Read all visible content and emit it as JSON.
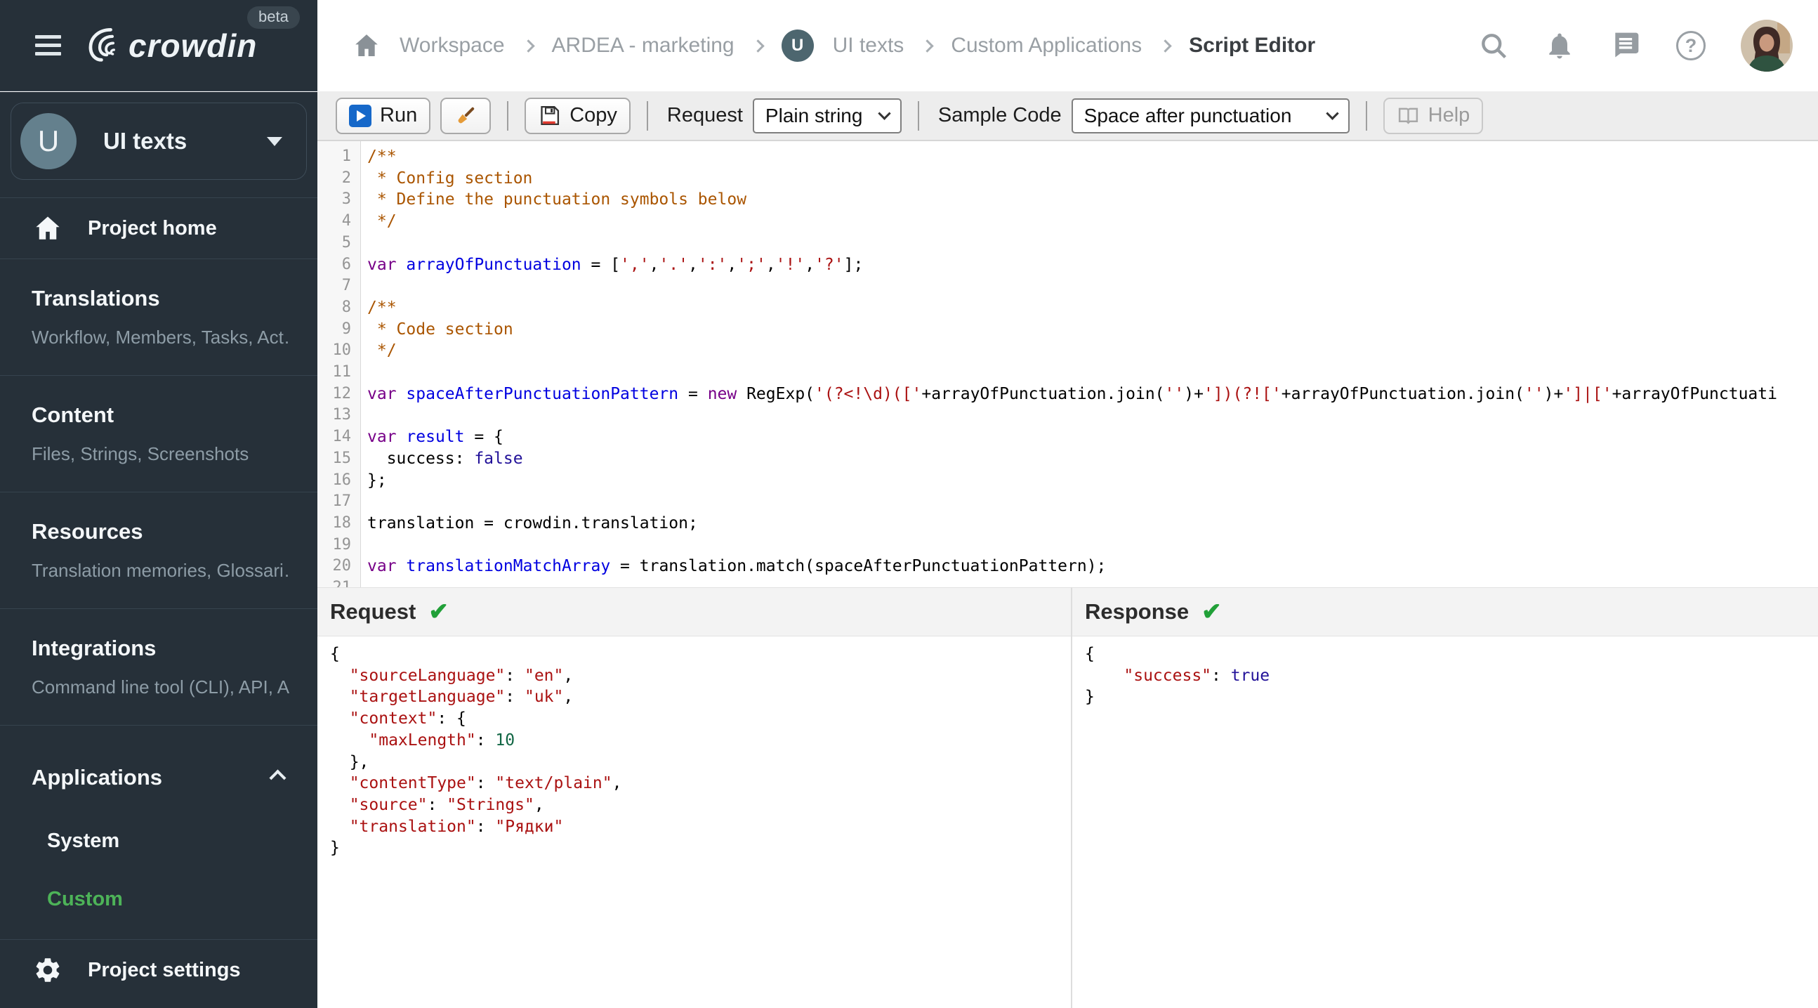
{
  "topbar": {
    "brand": "crowdin",
    "beta": "beta"
  },
  "breadcrumb": {
    "items": [
      "Workspace",
      "ARDEA - marketing",
      "UI texts",
      "Custom Applications",
      "Script Editor"
    ],
    "project_badge": "U"
  },
  "header_icons": [
    "search",
    "notifications",
    "messages",
    "help",
    "avatar"
  ],
  "toolbar": {
    "run": "Run",
    "copy": "Copy",
    "request_label": "Request",
    "request_value": "Plain string",
    "sample_label": "Sample Code",
    "sample_value": "Space after punctuation",
    "help": "Help"
  },
  "sidebar": {
    "project": {
      "initial": "U",
      "name": "UI texts"
    },
    "project_home": "Project home",
    "sections": [
      {
        "title": "Translations",
        "subtitle": "Workflow, Members, Tasks, Act…"
      },
      {
        "title": "Content",
        "subtitle": "Files, Strings, Screenshots"
      },
      {
        "title": "Resources",
        "subtitle": "Translation memories, Glossari…"
      },
      {
        "title": "Integrations",
        "subtitle": "Command line tool (CLI), API, A…"
      }
    ],
    "applications": {
      "title": "Applications",
      "items": [
        {
          "label": "System"
        },
        {
          "label": "Custom"
        }
      ]
    },
    "project_settings": "Project settings"
  },
  "editor": {
    "lines": [
      [
        {
          "t": "/**",
          "c": "com"
        }
      ],
      [
        {
          "t": " * Config section",
          "c": "com"
        }
      ],
      [
        {
          "t": " * Define the punctuation symbols below",
          "c": "com"
        }
      ],
      [
        {
          "t": " */",
          "c": "com"
        }
      ],
      [],
      [
        {
          "t": "var",
          "c": "kw"
        },
        {
          "t": " ",
          "c": ""
        },
        {
          "t": "arrayOfPunctuation",
          "c": "def"
        },
        {
          "t": " = [",
          "c": ""
        },
        {
          "t": "','",
          "c": "str"
        },
        {
          "t": ",",
          "c": ""
        },
        {
          "t": "'.'",
          "c": "str"
        },
        {
          "t": ",",
          "c": ""
        },
        {
          "t": "':'",
          "c": "str"
        },
        {
          "t": ",",
          "c": ""
        },
        {
          "t": "';'",
          "c": "str"
        },
        {
          "t": ",",
          "c": ""
        },
        {
          "t": "'!'",
          "c": "str"
        },
        {
          "t": ",",
          "c": ""
        },
        {
          "t": "'?'",
          "c": "str"
        },
        {
          "t": "];",
          "c": ""
        }
      ],
      [],
      [
        {
          "t": "/**",
          "c": "com"
        }
      ],
      [
        {
          "t": " * Code section",
          "c": "com"
        }
      ],
      [
        {
          "t": " */",
          "c": "com"
        }
      ],
      [],
      [
        {
          "t": "var",
          "c": "kw"
        },
        {
          "t": " ",
          "c": ""
        },
        {
          "t": "spaceAfterPunctuationPattern",
          "c": "def"
        },
        {
          "t": " = ",
          "c": ""
        },
        {
          "t": "new",
          "c": "kw"
        },
        {
          "t": " RegExp(",
          "c": ""
        },
        {
          "t": "'(?<!\\d)(['",
          "c": "str"
        },
        {
          "t": "+arrayOfPunctuation.join(",
          "c": ""
        },
        {
          "t": "''",
          "c": "str"
        },
        {
          "t": ")+",
          "c": ""
        },
        {
          "t": "'])(?!['",
          "c": "str"
        },
        {
          "t": "+arrayOfPunctuation.join(",
          "c": ""
        },
        {
          "t": "''",
          "c": "str"
        },
        {
          "t": ")+",
          "c": ""
        },
        {
          "t": "']|['",
          "c": "str"
        },
        {
          "t": "+arrayOfPunctuati",
          "c": ""
        }
      ],
      [],
      [
        {
          "t": "var",
          "c": "kw"
        },
        {
          "t": " ",
          "c": ""
        },
        {
          "t": "result",
          "c": "def"
        },
        {
          "t": " = {",
          "c": ""
        }
      ],
      [
        {
          "t": "  success: ",
          "c": ""
        },
        {
          "t": "false",
          "c": "atom"
        }
      ],
      [
        {
          "t": "};",
          "c": ""
        }
      ],
      [],
      [
        {
          "t": "translation = crowdin.translation;",
          "c": ""
        }
      ],
      [],
      [
        {
          "t": "var",
          "c": "kw"
        },
        {
          "t": " ",
          "c": ""
        },
        {
          "t": "translationMatchArray",
          "c": "def"
        },
        {
          "t": " = translation.match(spaceAfterPunctuationPattern);",
          "c": ""
        }
      ],
      []
    ]
  },
  "panels": {
    "check_glyph": "✔",
    "request": {
      "title": "Request",
      "lines": [
        [
          {
            "t": "{",
            "c": ""
          }
        ],
        [
          {
            "t": "  ",
            "c": ""
          },
          {
            "t": "\"sourceLanguage\"",
            "c": "str"
          },
          {
            "t": ": ",
            "c": ""
          },
          {
            "t": "\"en\"",
            "c": "str"
          },
          {
            "t": ",",
            "c": ""
          }
        ],
        [
          {
            "t": "  ",
            "c": ""
          },
          {
            "t": "\"targetLanguage\"",
            "c": "str"
          },
          {
            "t": ": ",
            "c": ""
          },
          {
            "t": "\"uk\"",
            "c": "str"
          },
          {
            "t": ",",
            "c": ""
          }
        ],
        [
          {
            "t": "  ",
            "c": ""
          },
          {
            "t": "\"context\"",
            "c": "str"
          },
          {
            "t": ": {",
            "c": ""
          }
        ],
        [
          {
            "t": "    ",
            "c": ""
          },
          {
            "t": "\"maxLength\"",
            "c": "str"
          },
          {
            "t": ": ",
            "c": ""
          },
          {
            "t": "10",
            "c": "num"
          }
        ],
        [
          {
            "t": "  },",
            "c": ""
          }
        ],
        [
          {
            "t": "  ",
            "c": ""
          },
          {
            "t": "\"contentType\"",
            "c": "str"
          },
          {
            "t": ": ",
            "c": ""
          },
          {
            "t": "\"text/plain\"",
            "c": "str"
          },
          {
            "t": ",",
            "c": ""
          }
        ],
        [
          {
            "t": "  ",
            "c": ""
          },
          {
            "t": "\"source\"",
            "c": "str"
          },
          {
            "t": ": ",
            "c": ""
          },
          {
            "t": "\"Strings\"",
            "c": "str"
          },
          {
            "t": ",",
            "c": ""
          }
        ],
        [
          {
            "t": "  ",
            "c": ""
          },
          {
            "t": "\"translation\"",
            "c": "str"
          },
          {
            "t": ": ",
            "c": ""
          },
          {
            "t": "\"Рядки\"",
            "c": "str"
          }
        ],
        [
          {
            "t": "}",
            "c": ""
          }
        ]
      ]
    },
    "response": {
      "title": "Response",
      "lines": [
        [
          {
            "t": "{",
            "c": ""
          }
        ],
        [
          {
            "t": "    ",
            "c": ""
          },
          {
            "t": "\"success\"",
            "c": "str"
          },
          {
            "t": ": ",
            "c": ""
          },
          {
            "t": "true",
            "c": "atom"
          }
        ],
        [
          {
            "t": "}",
            "c": ""
          }
        ]
      ]
    }
  },
  "colors": {
    "sidebar_bg": "#263039",
    "accent_green": "#4db358",
    "run_icon_blue": "#1668c9",
    "check_green": "#21a038",
    "code": {
      "comment": "#aa5500",
      "keyword": "#770088",
      "definition": "#0000e0",
      "string": "#aa1111",
      "atom": "#221199",
      "number": "#116644"
    }
  }
}
